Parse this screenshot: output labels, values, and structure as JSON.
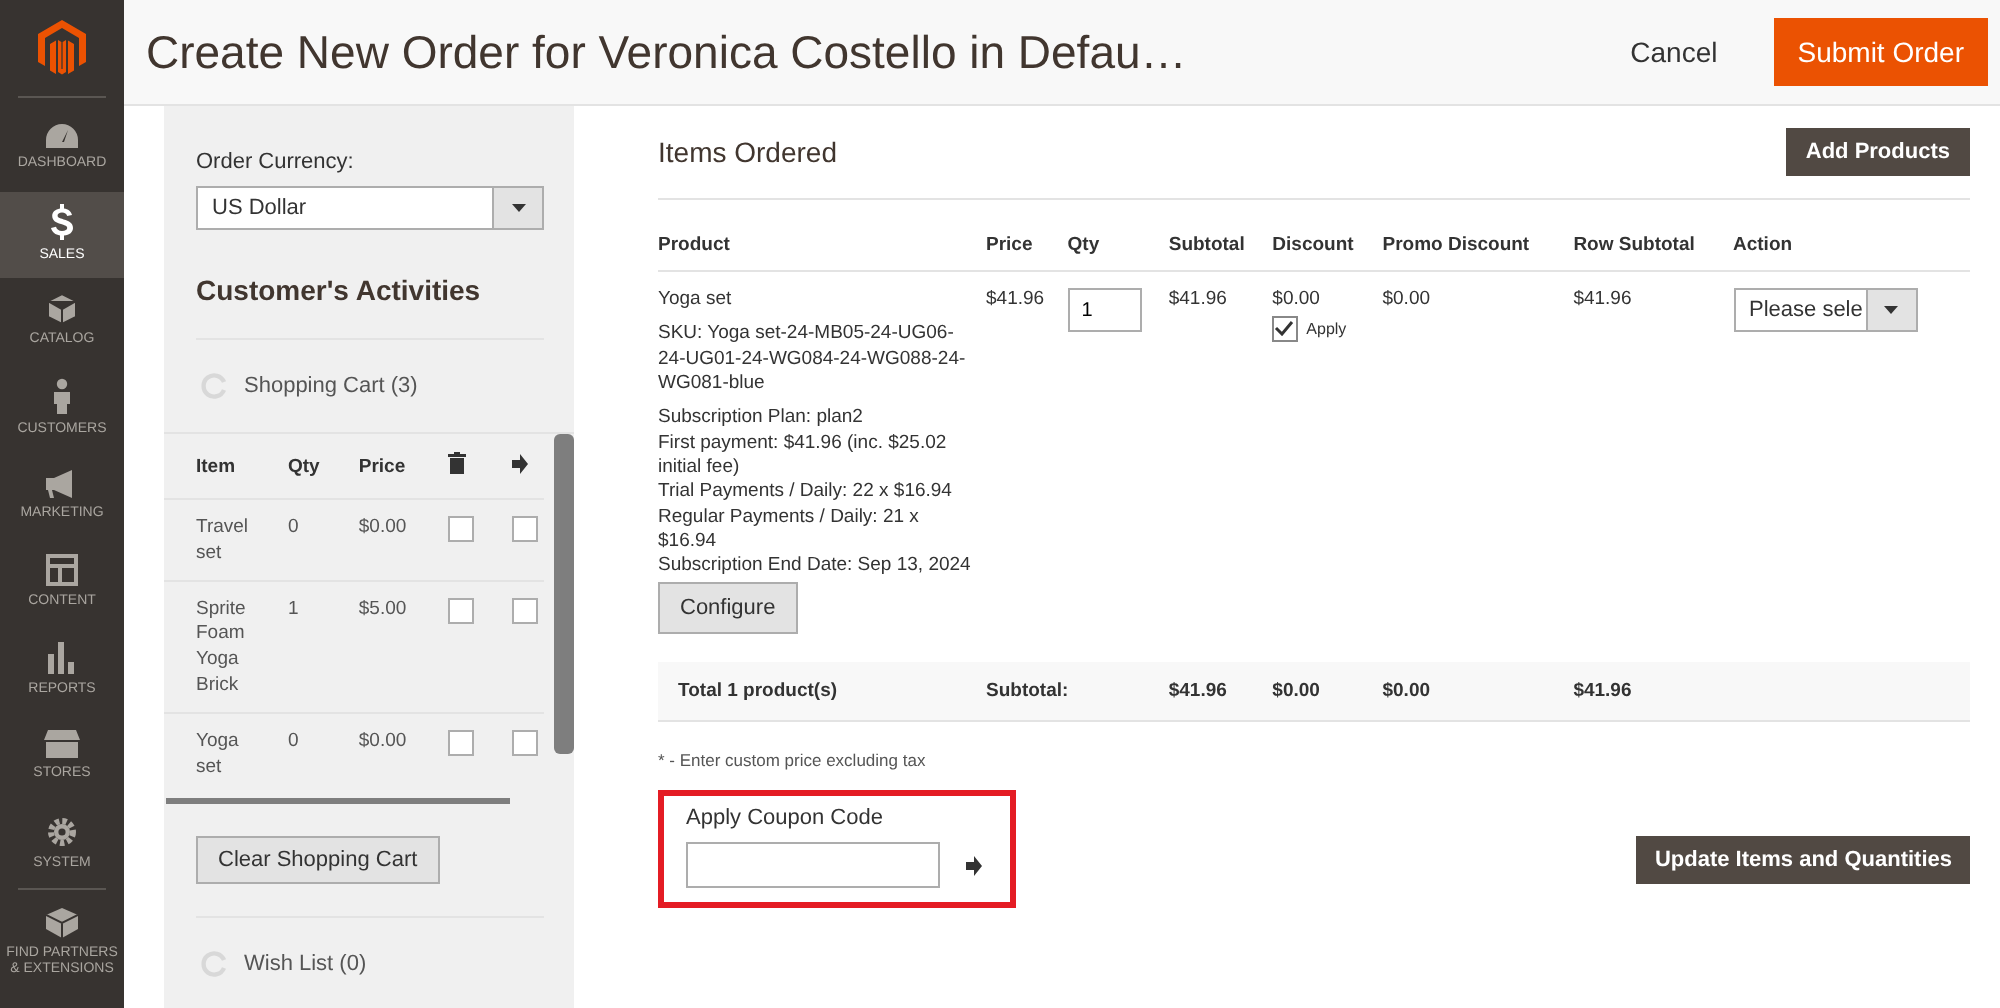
{
  "header": {
    "title": "Create New Order for Veronica Costello in Defau…",
    "cancel": "Cancel",
    "submit": "Submit Order"
  },
  "nav": [
    {
      "kind": "dashboard",
      "label": "DASHBOARD",
      "selected": false
    },
    {
      "kind": "sales",
      "label": "SALES",
      "selected": true
    },
    {
      "kind": "catalog",
      "label": "CATALOG",
      "selected": false
    },
    {
      "kind": "customers",
      "label": "CUSTOMERS",
      "selected": false
    },
    {
      "kind": "marketing",
      "label": "MARKETING",
      "selected": false
    },
    {
      "kind": "content",
      "label": "CONTENT",
      "selected": false
    },
    {
      "kind": "reports",
      "label": "REPORTS",
      "selected": false
    },
    {
      "kind": "stores",
      "label": "STORES",
      "selected": false
    },
    {
      "kind": "system",
      "label": "SYSTEM",
      "selected": false
    },
    {
      "kind": "partners",
      "label": "FIND PARTNERS & EXTENSIONS",
      "selected": false
    }
  ],
  "sidebar": {
    "currency_label": "Order Currency:",
    "currency": "US Dollar",
    "activities_title": "Customer's Activities",
    "cart_title": "Shopping Cart (3)",
    "cart_columns": [
      "Item",
      "Qty",
      "Price"
    ],
    "cart_rows": [
      {
        "item": "Travel set",
        "qty": "0",
        "price": "$0.00",
        "remove": false,
        "move": false
      },
      {
        "item": "Sprite Foam Yoga Brick",
        "qty": "1",
        "price": "$5.00",
        "remove": false,
        "move": false
      },
      {
        "item": "Yoga set",
        "qty": "0",
        "price": "$0.00",
        "remove": false,
        "move": false
      }
    ],
    "clear_button": "Clear Shopping Cart",
    "wishlist_title": "Wish List (0)"
  },
  "items": {
    "title": "Items Ordered",
    "add_button": "Add Products",
    "columns": [
      "Product",
      "Price",
      "Qty",
      "Subtotal",
      "Discount",
      "Promo Discount",
      "Row Subtotal",
      "Action"
    ],
    "rows": [
      {
        "name": "Yoga set",
        "sku": "SKU: Yoga set-24-MB05-24-UG06-24-UG01-24-WG084-24-WG088-24-WG081-blue",
        "details": [
          "Subscription Plan: plan2",
          "First payment: $41.96 (inc. $25.02 initial fee)",
          "Trial Payments / Daily: 22 x $16.94",
          "Regular Payments / Daily: 21 x $16.94",
          "Subscription End Date: Sep 13, 2024"
        ],
        "configure": "Configure",
        "price": "$41.96",
        "qty": "1",
        "subtotal": "$41.96",
        "discount": "$0.00",
        "apply_label": "Apply",
        "apply": true,
        "promo": "$0.00",
        "row_subtotal": "$41.96",
        "action": "Please sele"
      }
    ],
    "total": {
      "label": "Total 1 product(s)",
      "subtotal_label": "Subtotal:",
      "subtotal": "$41.96",
      "discount": "$0.00",
      "promo": "$0.00",
      "row_subtotal": "$41.96"
    },
    "note": "* - Enter custom price excluding tax",
    "coupon_label": "Apply Coupon Code",
    "update_button": "Update Items and Quantities"
  }
}
